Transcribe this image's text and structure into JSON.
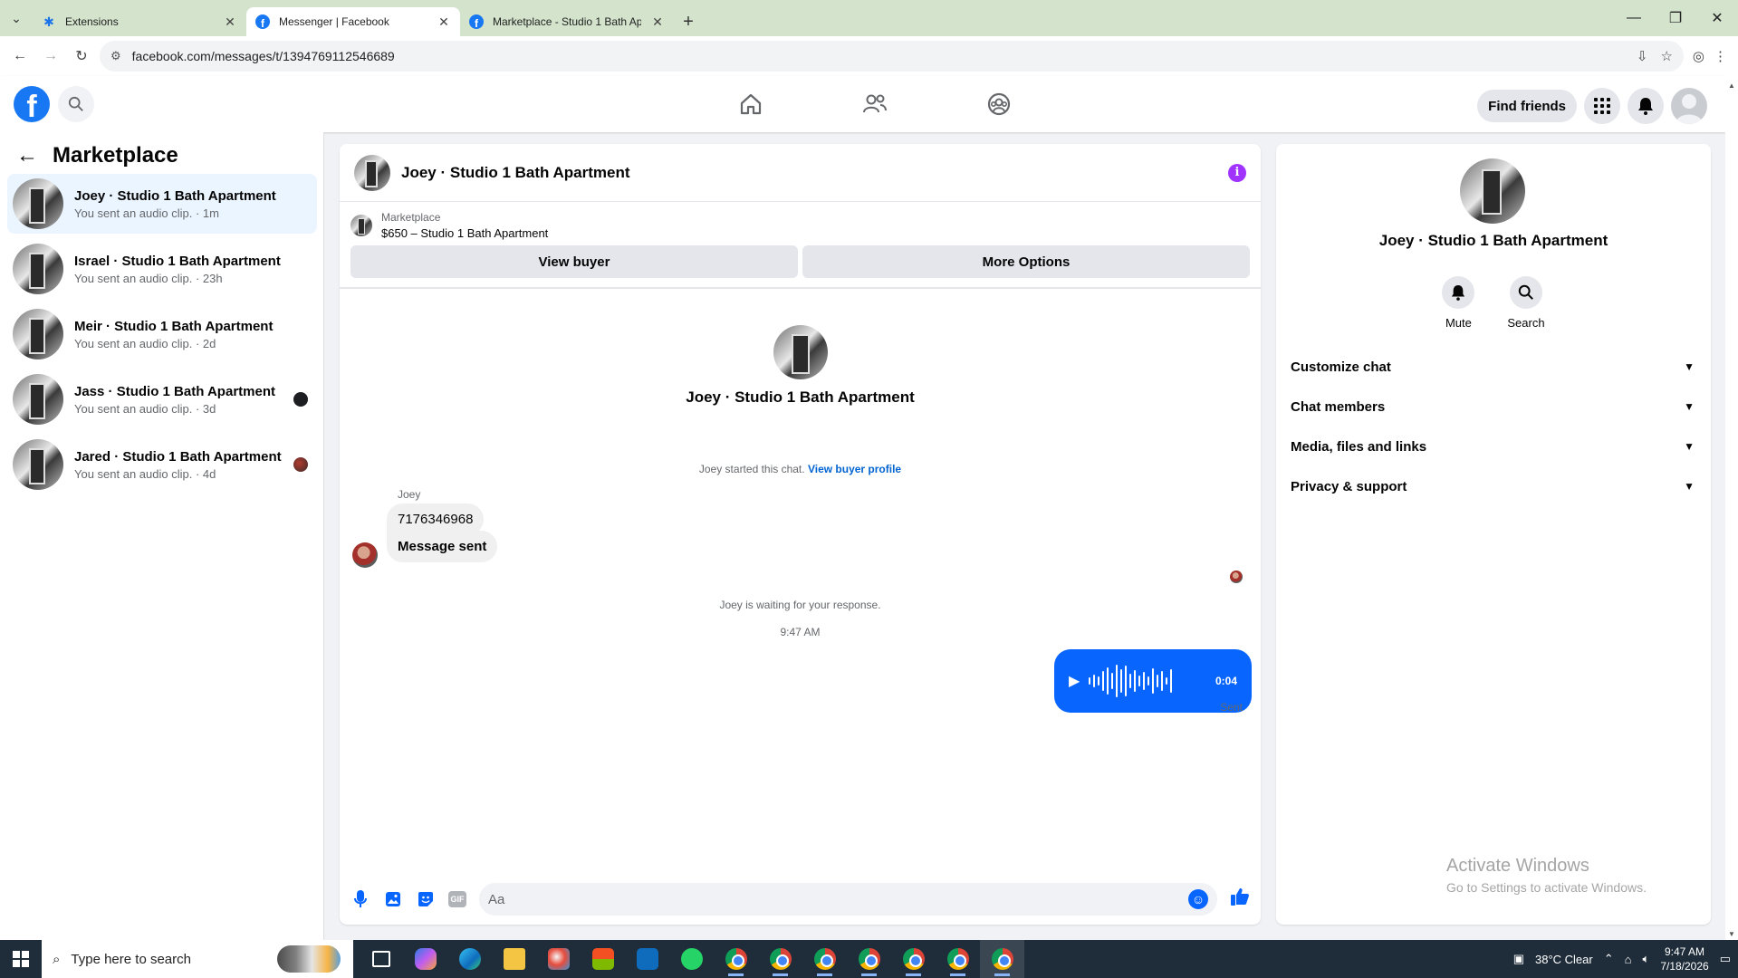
{
  "browser": {
    "tabs": [
      {
        "label": "Extensions",
        "icon": "puzzle-icon",
        "active": false
      },
      {
        "label": "Messenger | Facebook",
        "icon": "facebook-icon",
        "active": true
      },
      {
        "label": "Marketplace - Studio 1 Bath Ap",
        "icon": "facebook-icon",
        "active": false
      }
    ],
    "url": "facebook.com/messages/t/1394769112546689"
  },
  "fbnav": {
    "logo": "f",
    "find_friends": "Find friends"
  },
  "sidebar": {
    "title": "Marketplace",
    "chats": [
      {
        "name": "Joey · Studio 1 Bath Apartment",
        "preview": "You sent an audio clip. · 1m"
      },
      {
        "name": "Israel · Studio 1 Bath Apartment",
        "preview": "You sent an audio clip. · 23h"
      },
      {
        "name": "Meir · Studio 1 Bath Apartment",
        "preview": "You sent an audio clip. · 2d"
      },
      {
        "name": "Jass · Studio 1 Bath Apartment",
        "preview": "You sent an audio clip. · 3d"
      },
      {
        "name": "Jared · Studio 1 Bath Apartment",
        "preview": "You sent an audio clip. · 4d"
      }
    ]
  },
  "conversation": {
    "title": "Joey · Studio 1 Bath Apartment",
    "marketplace_label": "Marketplace",
    "listing": "$650 – Studio 1 Bath Apartment",
    "view_buyer": "View buyer",
    "more_options": "More Options",
    "intro_name": "Joey · Studio 1 Bath Apartment",
    "started_text": "Joey started this chat.",
    "view_buyer_profile": "View buyer profile",
    "sender": "Joey",
    "messages": [
      "7176346968",
      "Message sent"
    ],
    "waiting": "Joey is waiting for your response.",
    "time": "9:47 AM",
    "audio_duration": "0:04",
    "sent_status": "Sent",
    "composer_placeholder": "Aa",
    "composer_value": ""
  },
  "details": {
    "name": "Joey · Studio 1 Bath Apartment",
    "actions": [
      {
        "label": "Mute"
      },
      {
        "label": "Search"
      }
    ],
    "sections": [
      "Customize chat",
      "Chat members",
      "Media, files and links",
      "Privacy & support"
    ]
  },
  "watermark": {
    "line1": "Activate Windows",
    "line2": "Go to Settings to activate Windows."
  },
  "taskbar": {
    "search_placeholder": "Type here to search",
    "weather": "38°C  Clear",
    "time": "9:47 AM",
    "date": "7/18/2026"
  },
  "colors": {
    "accent": "#0866ff",
    "fb_blue": "#1877f2",
    "info_purple": "#a033ff"
  }
}
